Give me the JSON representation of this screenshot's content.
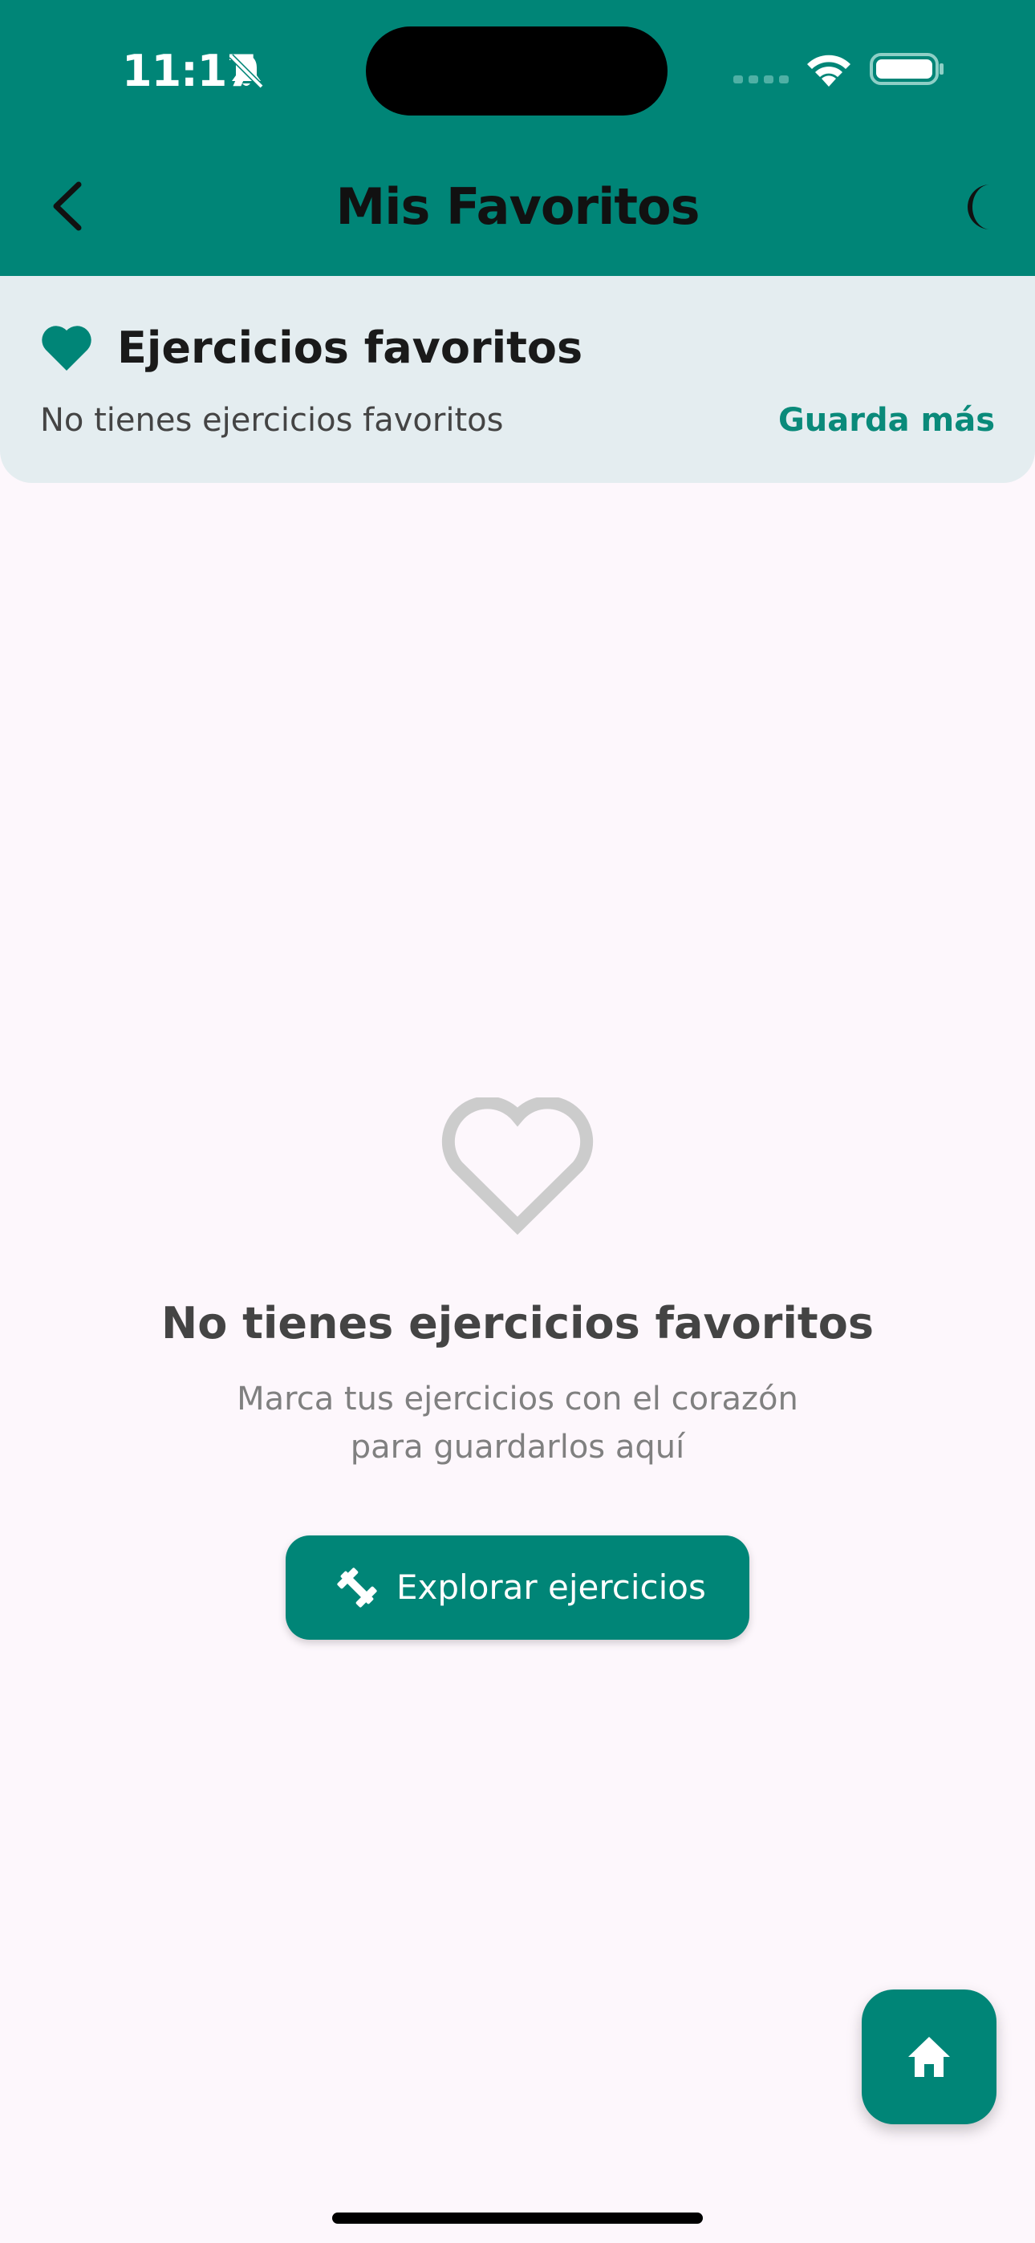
{
  "status_bar": {
    "time": "11:17",
    "icons": [
      "bell-slash-icon",
      "signal-icon",
      "wifi-icon",
      "battery-icon"
    ]
  },
  "app_bar": {
    "title": "Mis Favoritos",
    "back_icon": "chevron-left-icon",
    "theme_icon": "moon-icon"
  },
  "favorites_card": {
    "icon": "heart-icon",
    "title": "Ejercicios favoritos",
    "subtitle": "No tienes ejercicios favoritos",
    "link_label": "Guarda más"
  },
  "empty_state": {
    "icon": "heart-outline-icon",
    "title": "No tienes ejercicios favoritos",
    "message_line1": "Marca tus ejercicios con el corazón",
    "message_line2": "para guardarlos aquí",
    "button_icon": "dumbbell-icon",
    "button_label": "Explorar ejercicios"
  },
  "fab": {
    "icon": "home-icon"
  },
  "colors": {
    "primary": "#008577",
    "background": "#fdf7fc",
    "card_background": "#e4edf0",
    "link": "#0a8a7a",
    "empty_icon": "#cccccc"
  }
}
